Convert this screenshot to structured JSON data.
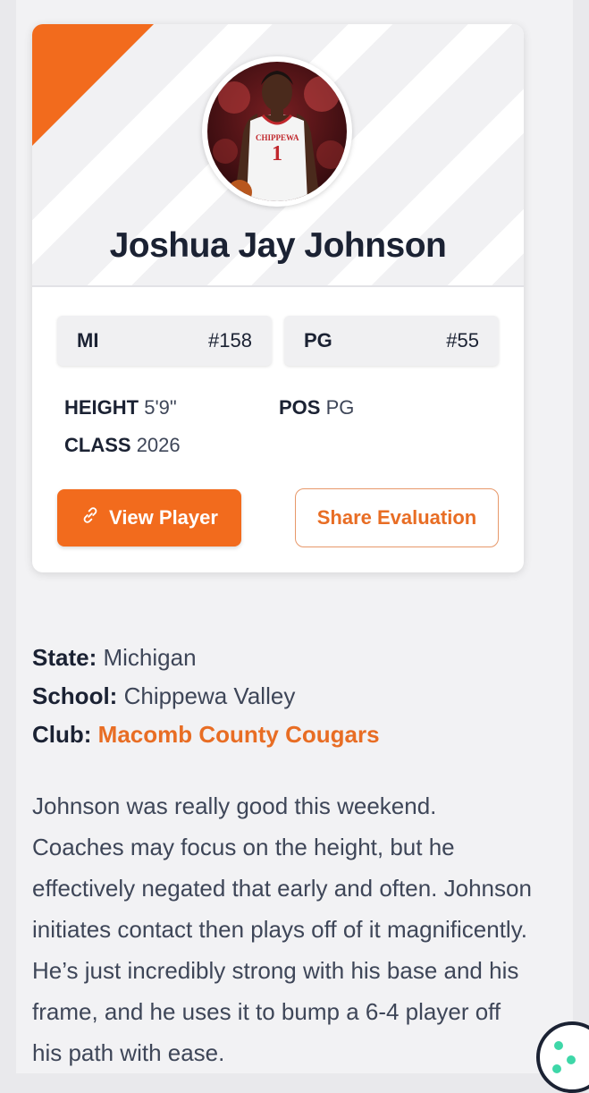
{
  "player": {
    "name": "Joshua Jay Johnson",
    "jersey_number": "1",
    "jersey_text": "CHIPPEWA"
  },
  "badges": {
    "state_label": "MI",
    "state_rank": "#158",
    "position_label": "PG",
    "position_rank": "#55"
  },
  "stats": {
    "height_label": "HEIGHT",
    "height_value": "5'9\"",
    "pos_label": "POS",
    "pos_value": "PG",
    "class_label": "CLASS",
    "class_value": "2026"
  },
  "buttons": {
    "view_player": "View Player",
    "share_evaluation": "Share Evaluation"
  },
  "info": {
    "state_label": "State:",
    "state_value": "Michigan",
    "school_label": "School:",
    "school_value": "Chippewa Valley",
    "club_label": "Club:",
    "club_value": "Macomb County Cougars"
  },
  "evaluation": {
    "text": "Johnson was really good this weekend. Coaches may focus on the height, but he effectively negated that early and often. Johnson initiates contact then plays off of it magnificently. He’s just incredibly strong with his base and his frame, and he uses it to bump a 6-4 player off his path with ease."
  },
  "colors": {
    "accent": "#f26b1d",
    "text_dark": "#1b2233",
    "text_body": "#3e4658"
  },
  "icons": {
    "view_player": "link-icon",
    "cookie": "cookie-icon"
  }
}
